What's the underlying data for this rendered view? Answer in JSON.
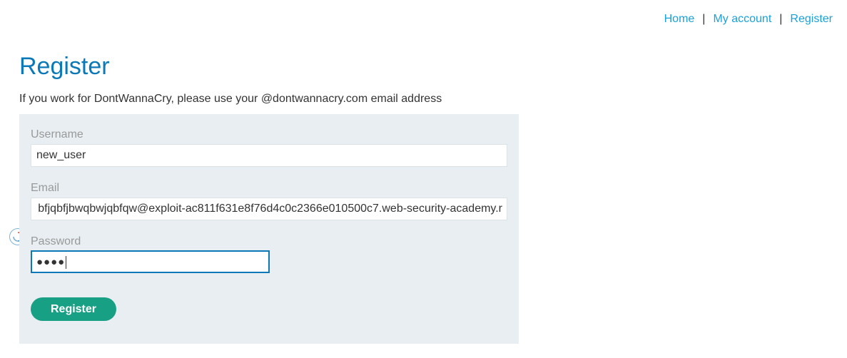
{
  "nav": {
    "home": "Home",
    "my_account": "My account",
    "register": "Register",
    "separator": "|"
  },
  "page": {
    "title": "Register",
    "intro": "If you work for DontWannaCry, please use your @dontwannacry.com email address"
  },
  "form": {
    "username_label": "Username",
    "username_value": "new_user",
    "email_label": "Email",
    "email_value": "bfjqbfjbwqbwjqbfqw@exploit-ac811f631e8f76d4c0c2366e010500c7.web-security-academy.r",
    "password_label": "Password",
    "password_masked": "●●●●",
    "submit_label": "Register"
  },
  "icons": {
    "extension": "sync-circle-icon"
  },
  "colors": {
    "link": "#1ba1d9",
    "title": "#0b78b8",
    "panel_bg": "#e8eef1",
    "button": "#18a085",
    "focus_border": "#0b78b8"
  }
}
